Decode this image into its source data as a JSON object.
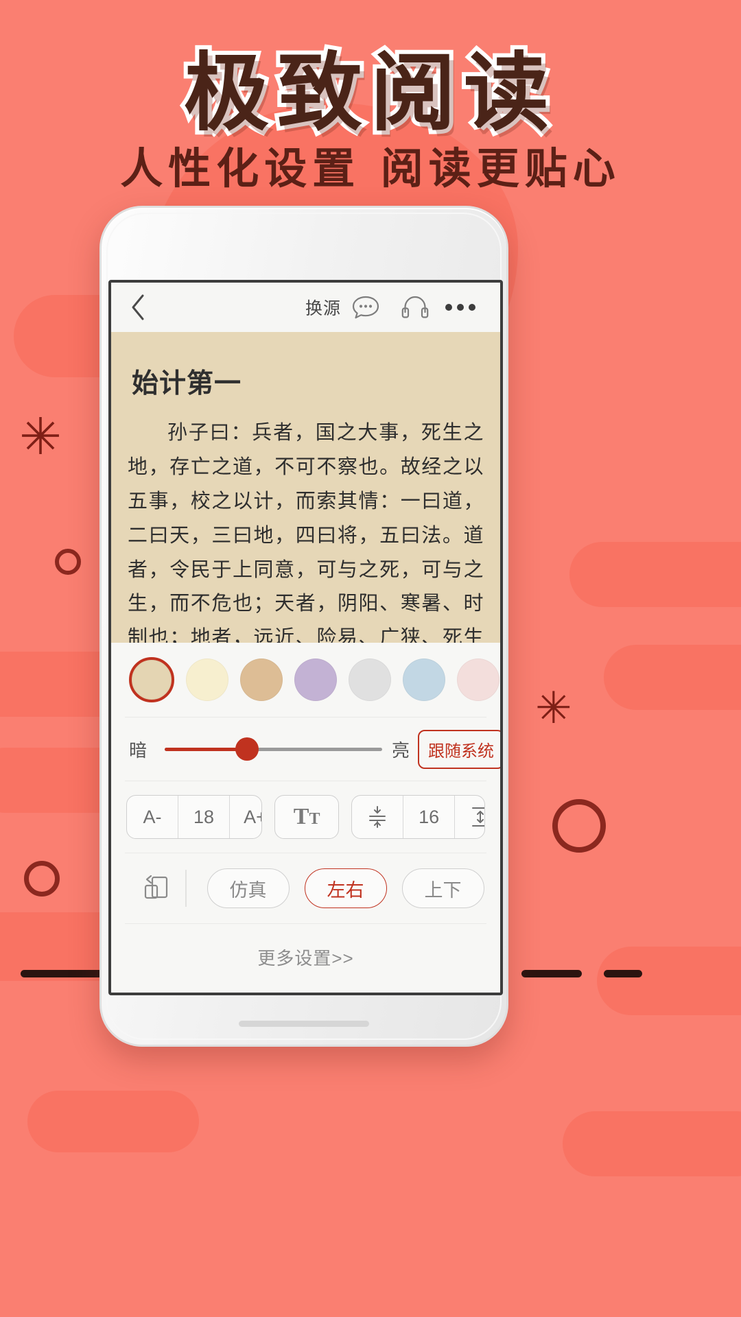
{
  "promo": {
    "headline": "极致阅读",
    "subline": "人性化设置  阅读更贴心",
    "background_color": "#fa7f71",
    "headline_color": "#4a2418",
    "accent_color": "#c0321f"
  },
  "navbar": {
    "back_icon": "chevron-left-icon",
    "title": "换源",
    "comment_icon": "chat-bubble-icon",
    "listen_icon": "headphones-icon",
    "more_icon": "ellipsis-icon"
  },
  "reader": {
    "background_color": "#e6d7b7",
    "chapter_title": "始计第一",
    "paragraph": "孙子曰：兵者，国之大事，死生之地，存亡之道，不可不察也。故经之以五事，校之以计，而索其情：一曰道，二曰天，三曰地，四曰将，五曰法。道者，令民于上同意，可与之死，可与之生，而不危也；天者，阴阳、寒暑、时制也；地者，远近、险易、广狭、死生也；将者，智、"
  },
  "settings": {
    "themes": [
      {
        "name": "theme-beige",
        "color": "#e4d5b3",
        "selected": true
      },
      {
        "name": "theme-cream",
        "color": "#f7efcf",
        "selected": false
      },
      {
        "name": "theme-tan",
        "color": "#ddbd95",
        "selected": false
      },
      {
        "name": "theme-purple",
        "color": "#c3b2d4",
        "selected": false
      },
      {
        "name": "theme-gray",
        "color": "#e0e0e0",
        "selected": false
      },
      {
        "name": "theme-blue",
        "color": "#c2d7e4",
        "selected": false
      },
      {
        "name": "theme-pink",
        "color": "#f3dedc",
        "selected": false
      }
    ],
    "brightness": {
      "dark_label": "暗",
      "bright_label": "亮",
      "value_percent": 38,
      "follow_system_label": "跟随系统",
      "follow_system_active": true
    },
    "font": {
      "decrease_label": "A-",
      "size_value": "18",
      "increase_label": "A+",
      "typeface_icon": "typeface-tt-icon"
    },
    "line_spacing": {
      "decrease_icon": "line-spacing-decrease-icon",
      "value": "16",
      "increase_icon": "line-spacing-increase-icon"
    },
    "page_turn": {
      "mode_icon": "page-flip-icon",
      "options": [
        {
          "label": "仿真",
          "active": false
        },
        {
          "label": "左右",
          "active": true
        },
        {
          "label": "上下",
          "active": false
        }
      ]
    },
    "more_settings_label": "更多设置>>"
  }
}
